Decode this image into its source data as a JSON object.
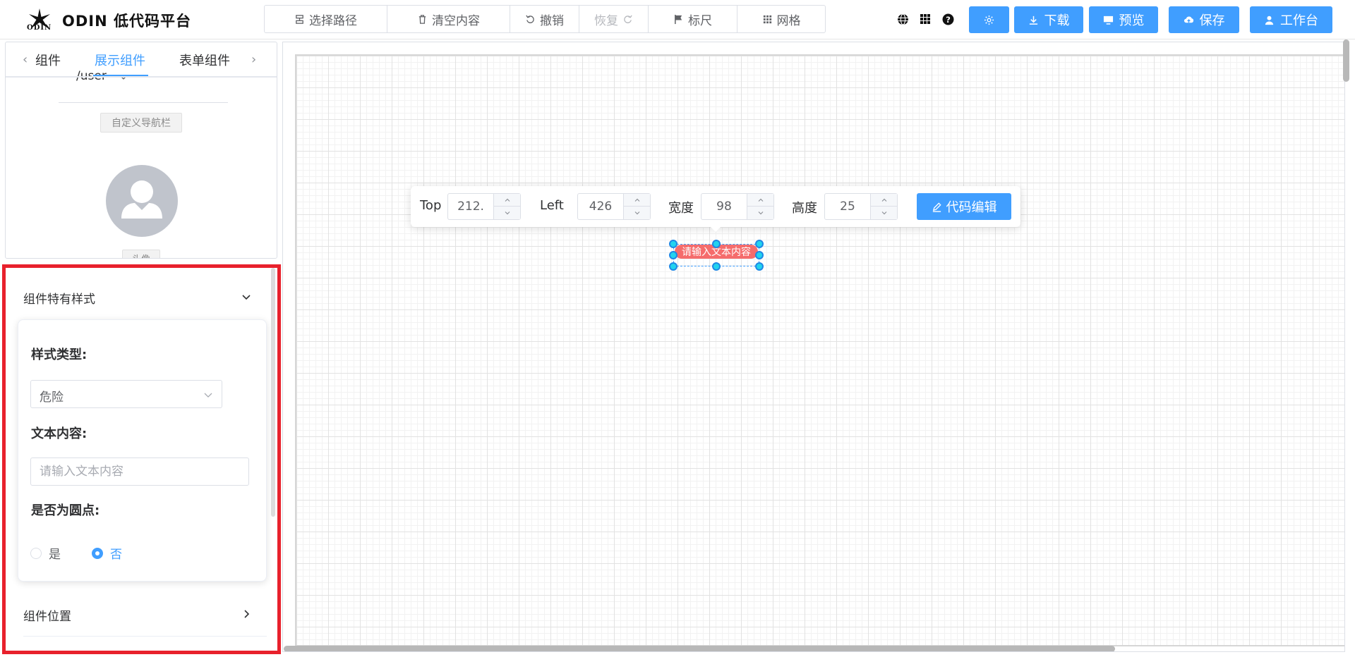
{
  "app": {
    "logo_text": "ODIN",
    "title": "ODIN 低代码平台"
  },
  "toolbar": {
    "select_path": "选择路径",
    "clear": "清空内容",
    "undo": "撤销",
    "redo": "恢复",
    "ruler": "标尺",
    "grid": "网格"
  },
  "actions": {
    "download": "下载",
    "preview": "预览",
    "save": "保存",
    "workbench": "工作台"
  },
  "component_panel": {
    "tabs": [
      "组件",
      "展示组件",
      "表单组件"
    ],
    "active_tab": "展示组件",
    "nav_path": "/user",
    "nav_more": "...",
    "custom_nav_label": "自定义导航栏",
    "avatar_label": "头像"
  },
  "style_panel": {
    "section_title": "组件特有样式",
    "style_type_label": "样式类型:",
    "style_type_value": "危险",
    "text_content_label": "文本内容:",
    "text_content_placeholder": "请输入文本内容",
    "is_dot_label": "是否为圆点:",
    "radio_yes": "是",
    "radio_no": "否",
    "radio_selected": "否",
    "position_section_title": "组件位置"
  },
  "position_toolbar": {
    "top_label": "Top",
    "top_value": "212.",
    "left_label": "Left",
    "left_value": "426",
    "width_label": "宽度",
    "width_value": "98",
    "height_label": "高度",
    "height_value": "25",
    "code_edit": "代码编辑"
  },
  "canvas": {
    "badge_text": "请输入文本内容",
    "badge_color": "#f56c6c"
  },
  "colors": {
    "primary": "#409eff",
    "highlight_border": "#e8212c"
  }
}
